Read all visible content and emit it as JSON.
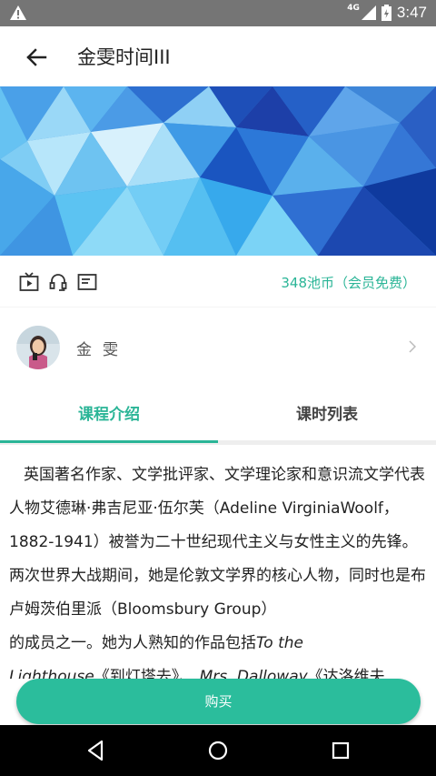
{
  "status_bar": {
    "time": "3:47",
    "network": "4G"
  },
  "app_bar": {
    "title": "金雯时间III"
  },
  "course_info": {
    "price": "348池币（会员免费）",
    "icons": [
      "video-icon",
      "audio-icon",
      "text-icon"
    ]
  },
  "teacher": {
    "name": "金雯"
  },
  "tabs": [
    {
      "label": "课程介绍"
    },
    {
      "label": "课时列表"
    }
  ],
  "description": {
    "lines": [
      "英国著名作家、文学批评家、文学理论家和意识流文学",
      "代表人物艾德琳·弗吉尼亚·伍尔芙（Adeline Virginia",
      "Woolf，1882-1941）被誉为二十世纪现代主义与女性主",
      "义的先锋。两次世界大战期间，她是伦敦文学界的核心",
      "人物，同时也是布卢姆茨伯里派（Bloomsbury Group）",
      "的成员之一。她为人熟知的作品包括",
      "To the",
      "Lighthouse",
      "《到灯塔去》、",
      "Mrs. Dalloway",
      "《达洛维夫"
    ]
  },
  "buy_button": {
    "label": "购买"
  },
  "colors": {
    "accent": "#2bb597",
    "button": "#2bbd9c",
    "status_bar": "#757575",
    "nav_bar": "#000000"
  }
}
